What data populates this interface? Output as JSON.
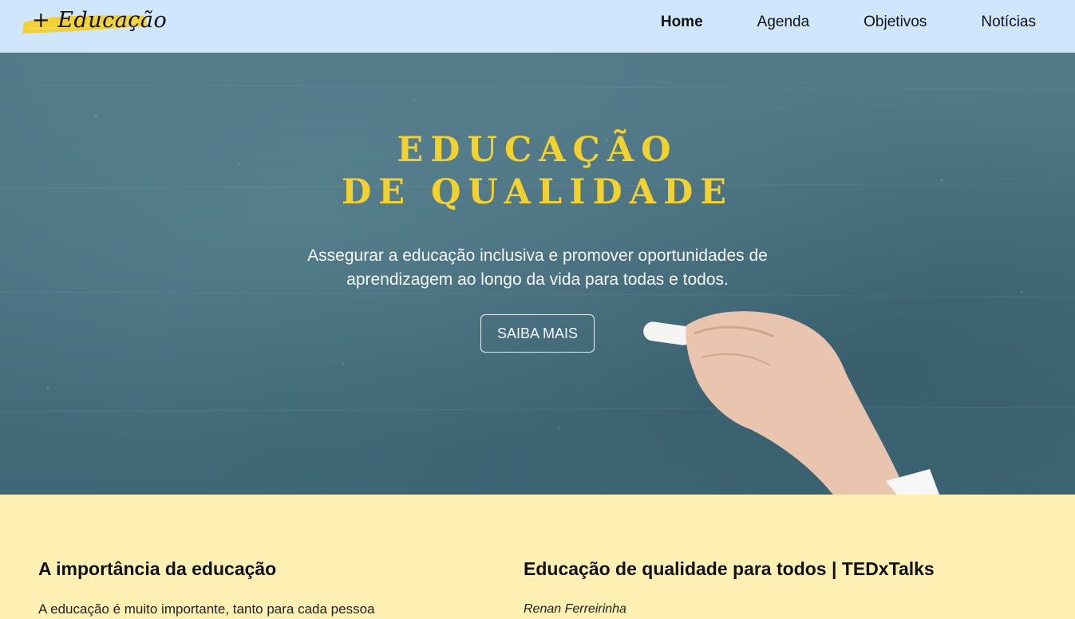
{
  "header": {
    "logo_text": "+ Educação",
    "nav": [
      {
        "label": "Home",
        "active": true
      },
      {
        "label": "Agenda",
        "active": false
      },
      {
        "label": "Objetivos",
        "active": false
      },
      {
        "label": "Notícias",
        "active": false
      }
    ]
  },
  "hero": {
    "title_line1": "EDUCAÇÃO",
    "title_line2": "DE QUALIDADE",
    "subtitle_line1": "Assegurar a educação inclusiva e promover oportunidades de",
    "subtitle_line2": "aprendizagem ao longo da vida para todas e todos.",
    "button_label": "SAIBA MAIS"
  },
  "sections": {
    "left": {
      "heading": "A importância da educação",
      "text": "A educação é muito importante, tanto para cada pessoa"
    },
    "right": {
      "heading": "Educação de qualidade para todos | TEDxTalks",
      "author": "Renan Ferreirinha"
    }
  },
  "colors": {
    "header_bg": "#cfe6fd",
    "accent_yellow": "#f3d22f",
    "content_bg": "#fdf0b2",
    "chalkboard": "#46707f"
  }
}
